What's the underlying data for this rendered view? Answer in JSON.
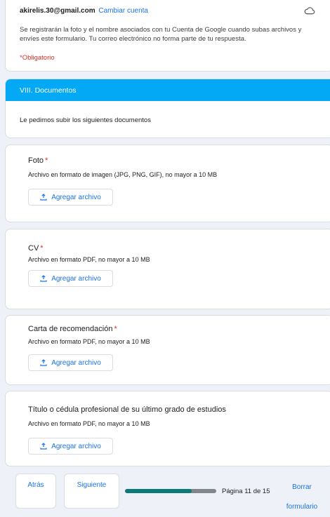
{
  "account": {
    "email": "akirelis.30@gmail.com",
    "switch_label": "Cambiar cuenta",
    "notice": "Se registrarán la foto y el nombre asociados con tu Cuenta de Google cuando subas archivos y envíes este formulario. Tu correo electrónico no forma parte de tu respuesta.",
    "required_note": "*Obligatorio",
    "icon": "cloud-icon"
  },
  "section": {
    "title": "VIII. Documentos",
    "description": "Le pedimos subir los siguientes documentos",
    "accent_color": "#03a9f4"
  },
  "questions": [
    {
      "title": "Foto",
      "required_mark": "*",
      "help": "Archivo en formato de imagen (JPG, PNG, GIF), no mayor a 10 MB",
      "button_label": "Agregar archivo"
    },
    {
      "title": "CV",
      "required_mark": "*",
      "help": "Archivo en formato PDF, no mayor a 10 MB",
      "button_label": "Agregar archivo"
    },
    {
      "title": "Carta de recomendación",
      "required_mark": "*",
      "help": "Archivo en formato PDF, no mayor a 10 MB",
      "button_label": "Agregar archivo"
    },
    {
      "title": "Título o cédula profesional de su último grado de estudios",
      "help": "Archivo en formato PDF, no mayor a 10 MB",
      "button_label": "Agregar archivo"
    }
  ],
  "footer": {
    "back_label": "Atrás",
    "next_label": "Siguiente",
    "page_indicator": "Página 11 de 15",
    "progress_fraction": 0.7333,
    "clear_label_line1": "Borrar",
    "clear_label_line2": "formulario",
    "progress_color": "#0d7a7a"
  }
}
